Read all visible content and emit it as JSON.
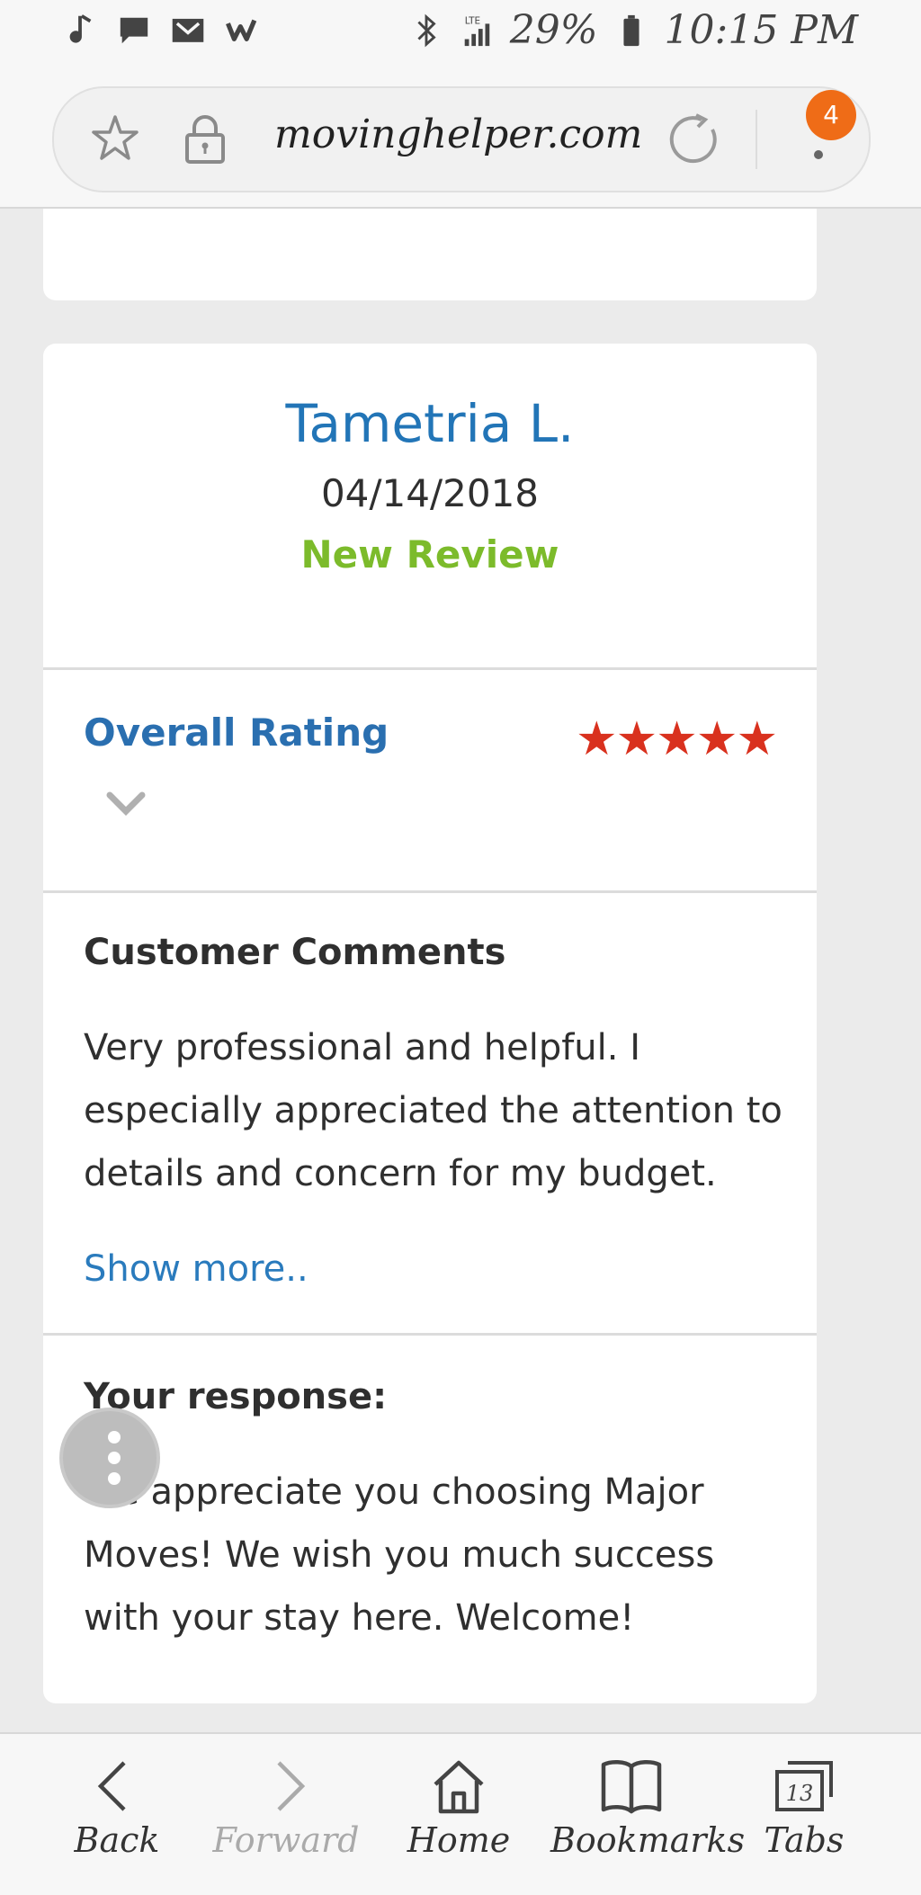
{
  "status_bar": {
    "battery": "29%",
    "time": "10:15 PM",
    "network": "LTE",
    "icons": [
      "music-note-icon",
      "message-icon",
      "gmail-icon",
      "w-app-icon",
      "bluetooth-icon",
      "signal-icon",
      "battery-icon"
    ]
  },
  "browser": {
    "url": "movinghelper.com",
    "notification_count": "4"
  },
  "review": {
    "reviewer_name": "Tametria L.",
    "date": "04/14/2018",
    "status": "New Review",
    "rating_label": "Overall Rating",
    "rating_value": 5,
    "rating_max": 5,
    "stars_text": "★★★★★",
    "comments_title": "Customer Comments",
    "comments_text": "Very professional and helpful. I especially appreciated the attention to details and concern for my budget.",
    "show_more_label": "Show more..",
    "response_title": "Your response:",
    "response_text": "We appreciate you choosing Major Moves! We wish you much success with your stay here. Welcome!"
  },
  "colors": {
    "link_blue": "#2275b7",
    "status_green": "#7cbb2b",
    "star_red": "#d9311e",
    "badge_orange": "#ef6c17"
  },
  "bottom_nav": {
    "back_label": "Back",
    "forward_label": "Forward",
    "home_label": "Home",
    "bookmarks_label": "Bookmarks",
    "tabs_label": "Tabs",
    "tabs_count": "13"
  }
}
